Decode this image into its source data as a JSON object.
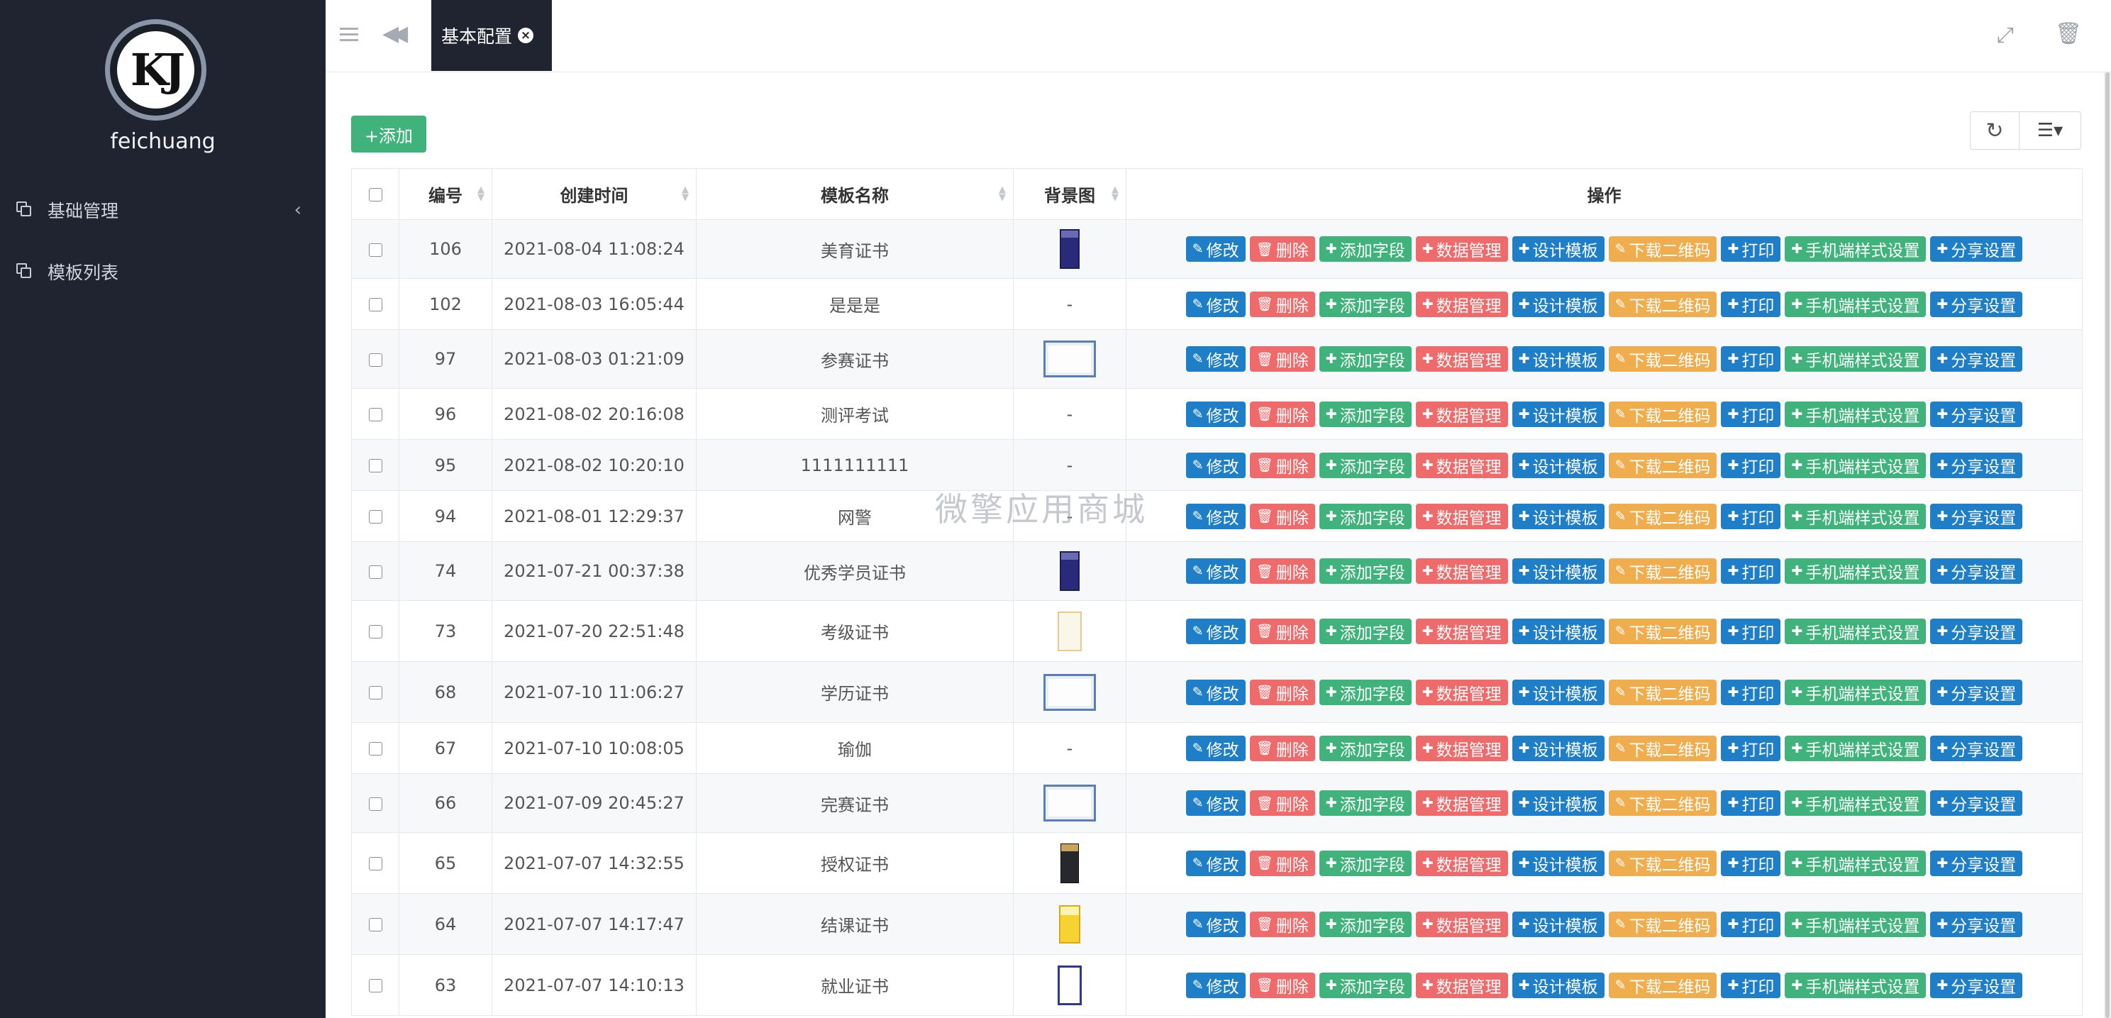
{
  "sidebar": {
    "logo_text": "KJ",
    "username": "feichuang",
    "items": [
      {
        "label": "基础管理",
        "icon": "copy-icon",
        "has_chevron": true
      },
      {
        "label": "模板列表",
        "icon": "copy-icon",
        "has_chevron": false
      }
    ]
  },
  "topbar": {
    "active_tab": "基本配置"
  },
  "toolbar": {
    "add_label": "+添加"
  },
  "table": {
    "columns": [
      "编号",
      "创建时间",
      "模板名称",
      "背景图",
      "操作"
    ],
    "actions": [
      {
        "label": "修改",
        "icon": "✎",
        "style": "b-edit"
      },
      {
        "label": "删除",
        "icon": "🗑",
        "style": "b-del"
      },
      {
        "label": "添加字段",
        "icon": "✚",
        "style": "b-green"
      },
      {
        "label": "数据管理",
        "icon": "✚",
        "style": "b-red"
      },
      {
        "label": "设计模板",
        "icon": "✚",
        "style": "b-blue"
      },
      {
        "label": "下载二维码",
        "icon": "✎",
        "style": "b-orange"
      },
      {
        "label": "打印",
        "icon": "✚",
        "style": "b-blue"
      },
      {
        "label": "手机端样式设置",
        "icon": "✚",
        "style": "b-green"
      },
      {
        "label": "分享设置",
        "icon": "✚",
        "style": "b-blue"
      }
    ],
    "rows": [
      {
        "id": "106",
        "created": "2021-08-04 11:08:24",
        "name": "美育证书",
        "bg": "navy-portrait"
      },
      {
        "id": "102",
        "created": "2021-08-03 16:05:44",
        "name": "是是是",
        "bg": "-"
      },
      {
        "id": "97",
        "created": "2021-08-03 01:21:09",
        "name": "参赛证书",
        "bg": "blue-landscape"
      },
      {
        "id": "96",
        "created": "2021-08-02 20:16:08",
        "name": "测评考试",
        "bg": "-"
      },
      {
        "id": "95",
        "created": "2021-08-02 10:20:10",
        "name": "1111111111",
        "bg": "-"
      },
      {
        "id": "94",
        "created": "2021-08-01 12:29:37",
        "name": "网警",
        "bg": "-"
      },
      {
        "id": "74",
        "created": "2021-07-21 00:37:38",
        "name": "优秀学员证书",
        "bg": "navy-portrait"
      },
      {
        "id": "73",
        "created": "2021-07-20 22:51:48",
        "name": "考级证书",
        "bg": "cream-portrait"
      },
      {
        "id": "68",
        "created": "2021-07-10 11:06:27",
        "name": "学历证书",
        "bg": "blue-landscape"
      },
      {
        "id": "67",
        "created": "2021-07-10 10:08:05",
        "name": "瑜伽",
        "bg": "-"
      },
      {
        "id": "66",
        "created": "2021-07-09 20:45:27",
        "name": "完赛证书",
        "bg": "blue-landscape"
      },
      {
        "id": "65",
        "created": "2021-07-07 14:32:55",
        "name": "授权证书",
        "bg": "dark-portrait"
      },
      {
        "id": "64",
        "created": "2021-07-07 14:17:47",
        "name": "结课证书",
        "bg": "yellow-portrait"
      },
      {
        "id": "63",
        "created": "2021-07-07 14:10:13",
        "name": "就业证书",
        "bg": "navy-outline-portrait"
      }
    ]
  },
  "watermark": "微擎应用商城"
}
